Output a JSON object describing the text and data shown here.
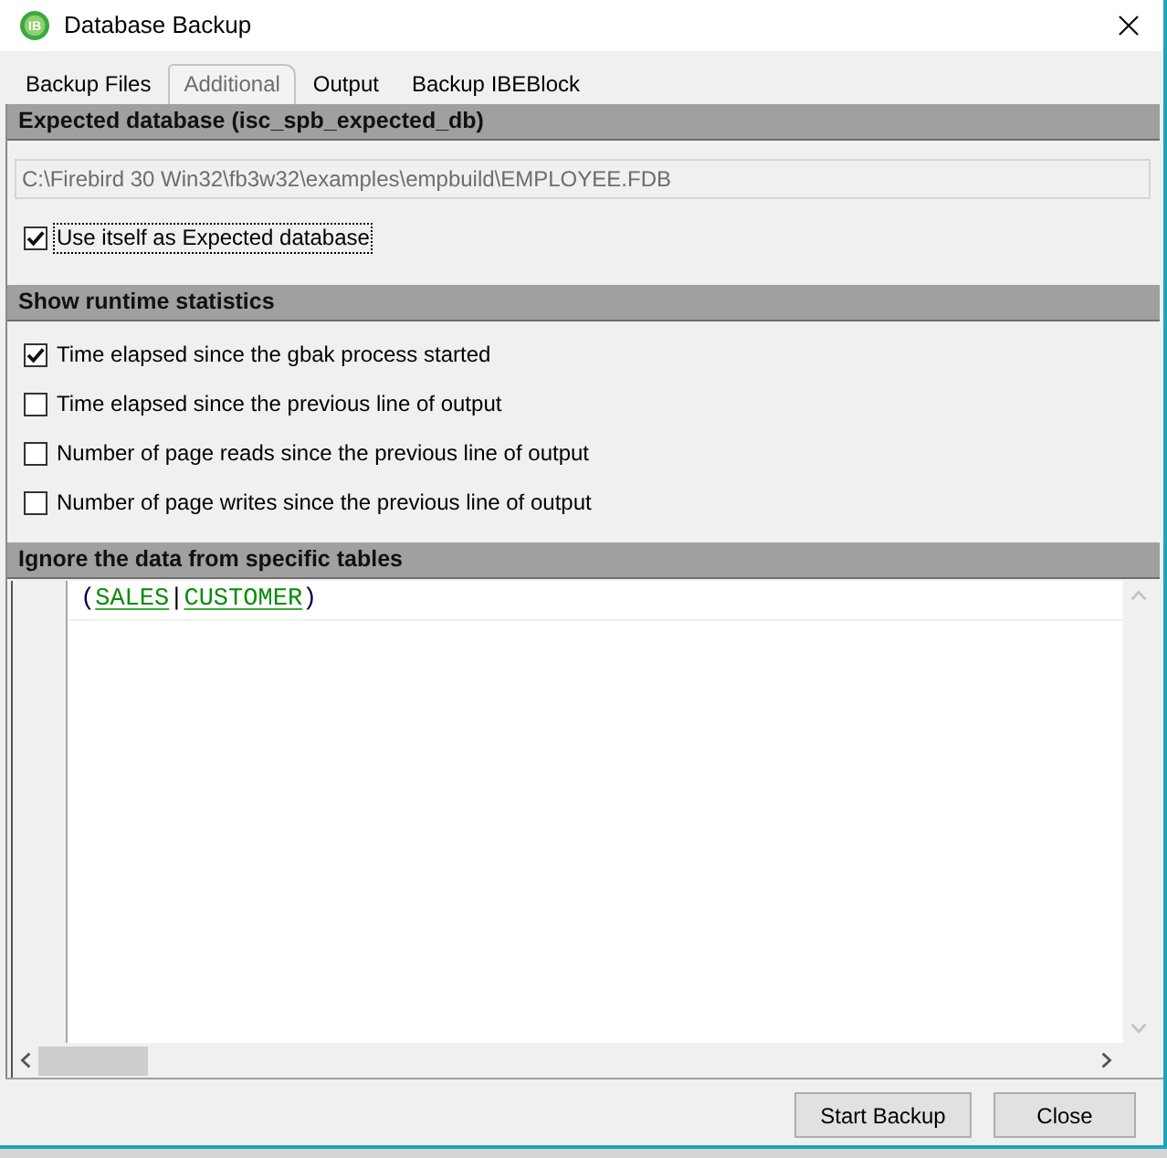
{
  "window": {
    "title": "Database Backup",
    "logo_text": "IB"
  },
  "tabs": [
    {
      "label": "Backup Files",
      "selected": false
    },
    {
      "label": "Additional",
      "selected": true
    },
    {
      "label": "Output",
      "selected": false
    },
    {
      "label": "Backup IBEBlock",
      "selected": false
    }
  ],
  "expected_database": {
    "heading": "Expected database (isc_spb_expected_db)",
    "path_field": {
      "value": "C:\\Firebird 30 Win32\\fb3w32\\examples\\empbuild\\EMPLOYEE.FDB",
      "disabled": true
    },
    "use_itself": {
      "label": "Use itself as Expected database",
      "checked": true,
      "focused": true
    }
  },
  "runtime_statistics": {
    "heading": "Show runtime statistics",
    "options": [
      {
        "label": "Time elapsed since the gbak process started",
        "checked": true
      },
      {
        "label": "Time elapsed since the previous line of output",
        "checked": false
      },
      {
        "label": "Number of page reads since the previous line of output",
        "checked": false
      },
      {
        "label": "Number of page writes since the previous line of output",
        "checked": false
      }
    ]
  },
  "ignore_tables": {
    "heading": "Ignore the data from specific tables",
    "editor": {
      "lines": [
        {
          "current": true,
          "tokens": [
            {
              "kind": "bracket",
              "text": "("
            },
            {
              "kind": "table_name",
              "text": "SALES"
            },
            {
              "kind": "operator",
              "text": "|"
            },
            {
              "kind": "table_name",
              "text": "CUSTOMER"
            },
            {
              "kind": "bracket",
              "text": ")"
            }
          ]
        }
      ]
    }
  },
  "buttons": [
    "Start Backup",
    "Close"
  ]
}
